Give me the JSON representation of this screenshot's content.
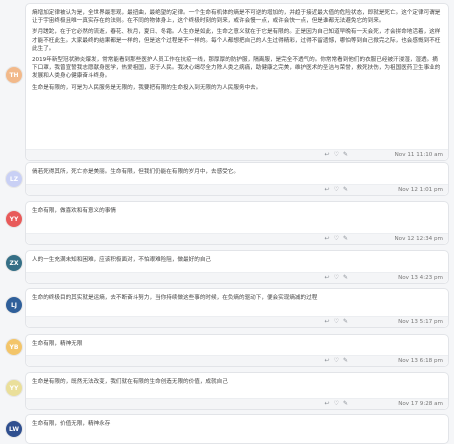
{
  "comments": [
    {
      "initials": "TH",
      "avatar_color": "#f2b98a",
      "paragraphs": [
        "熵增加定律被认为是，全世界最悲观，最扭曲，最绝望的定律。一个生命有机体的熵是不可逆的增加的，并趋于接近最大值的危险状态，即就是死亡。这个定律可谓是让于宇宙终极且唯一真实存在的法则。在不同的物体身上，这个终极时刻的到来，或许会慢一点，或许会快一点，但是谁都无法避免它的到来。",
        "岁月蹉跎，在于它必然的流逝，春花、秋月，夏日、冬霜。人生亦是如此，生命之意义就在于它是有限的。正是因为自己知道早晚有一天会死，才会拼命地活着，这样才能不枉此生。大家最终的结果都是一样的，但是这个过程是不一样的。每个人都想把自己的人生过得精彩，过得不留遗憾，哪怕等到自己掀完之际，也会感慨到不枉此生了。",
        "2019年新型冠状肺炎爆发，常常能看到那些医护人员工作在抗疫一线，那厚厚的防护服，隔离服，是完全不透气的。你常常看到他们的衣服已经被汗浸湿，湿透。摘下口罩，我曾宣誓我志愿献身医学，热爱祖国，忠于人民。我决心竭尽全力除人类之病痛，助健康之完美，维护医术的圣洁与荣誉，救死扶伤，为祖国医药卫生事业的发展和人类身心健康奋斗终身。",
        "生命是有限的，可是为人民服务是无限的，我要把有限的生命投入到无限的为人民服务中去。"
      ],
      "timestamp": "Nov 11 11:10 am"
    },
    {
      "initials": "LZ",
      "avatar_color": "#c9d0f5",
      "paragraphs": [
        "倘若死得其所，死亡亦是美丽。生命有限，但我们仍能在有限的岁月中，去感受它。"
      ],
      "timestamp": "Nov 12 1:01 pm"
    },
    {
      "initials": "YY",
      "avatar_color": "#e85a5a",
      "paragraphs": [
        "生命有限，做喜欢和有意义的事情"
      ],
      "timestamp": "Nov 12 12:34 pm"
    },
    {
      "initials": "ZX",
      "avatar_color": "#356f86",
      "paragraphs": [
        "人的一生充满未知和困难，应该积极面对，不怕艰难险阻，做最好的自己"
      ],
      "timestamp": "Nov 13 4:23 pm"
    },
    {
      "initials": "LJ",
      "avatar_color": "#2f5f9a",
      "paragraphs": [
        "生命的终极目的其实就是运熵，去不断奋斗努力，当你持续做这些事的时候，在负熵的驱动下，便会实现熵减的过程"
      ],
      "timestamp": "Nov 13 5:17 pm"
    },
    {
      "initials": "YB",
      "avatar_color": "#f3c56a",
      "paragraphs": [
        "生命有限，精神无限"
      ],
      "timestamp": "Nov 13 6:18 pm"
    },
    {
      "initials": "YY",
      "avatar_color": "#eadf9a",
      "paragraphs": [
        "生命是有限的，既然无法改变，我们就在有限的生命创造无限的价值，成就自己"
      ],
      "timestamp": "Nov 17 9:28 am"
    },
    {
      "initials": "LW",
      "avatar_color": "#2f4f8f",
      "paragraphs": [
        "生命有限，价值无限，精神永存"
      ],
      "timestamp": ""
    }
  ],
  "icons": {
    "reply": "reply-icon",
    "like": "like-icon",
    "mark": "mark-icon"
  }
}
